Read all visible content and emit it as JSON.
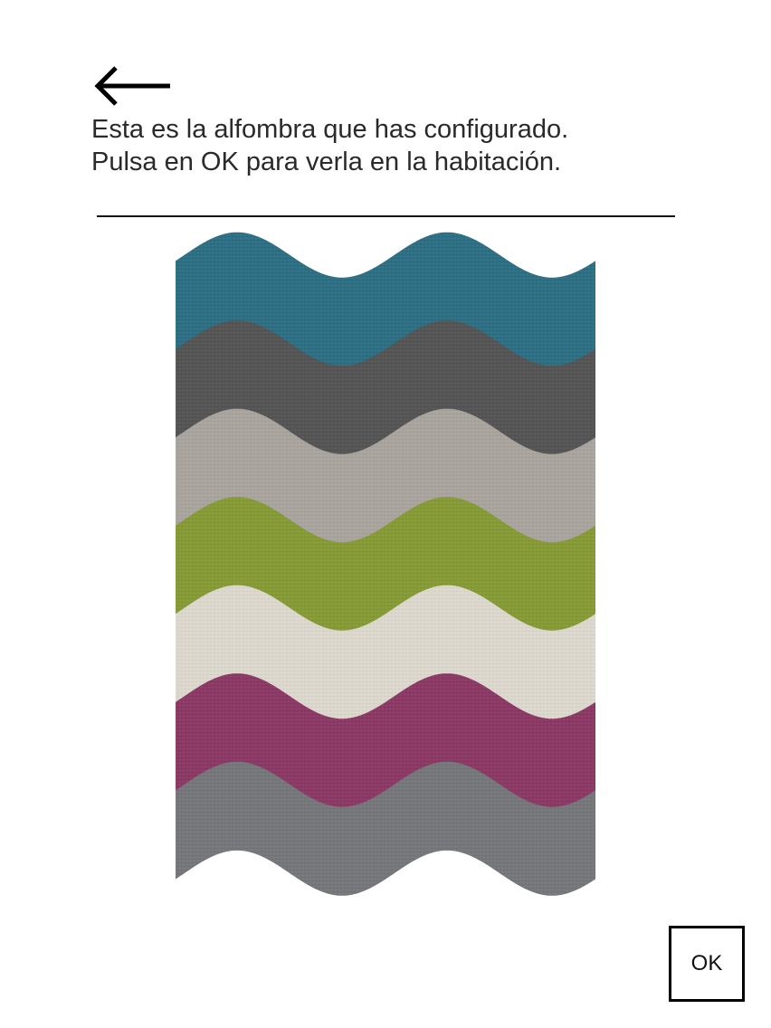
{
  "header": {
    "back_icon": "arrow-left-icon"
  },
  "instructions": {
    "line1": "Esta es la alfombra que has configurado.",
    "line2": "Pulsa en OK para verla en la habitación."
  },
  "rug": {
    "stripe_colors": [
      "#2e6f84",
      "#555555",
      "#aaa49f",
      "#869b37",
      "#dcd8ce",
      "#8b3a66",
      "#76777b"
    ]
  },
  "footer": {
    "ok_label": "OK"
  }
}
